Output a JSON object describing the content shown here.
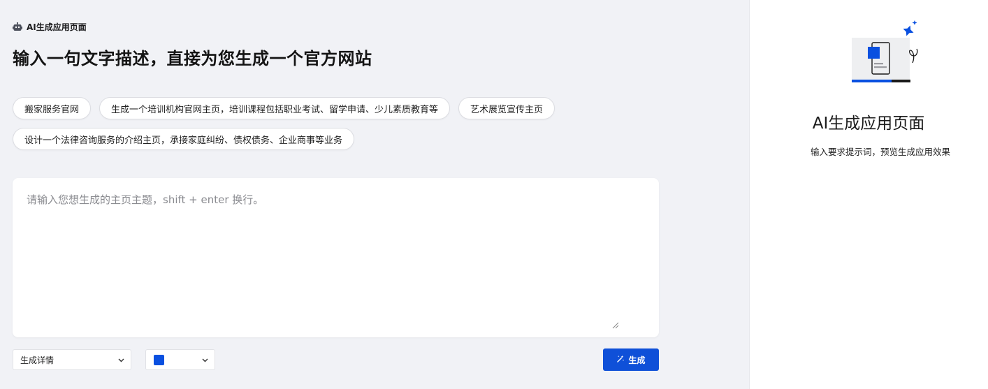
{
  "header": {
    "breadcrumb": "AI生成应用页面",
    "headline": "输入一句文字描述，直接为您生成一个官方网站",
    "robot_icon": "robot-icon"
  },
  "suggestions": [
    "搬家服务官网",
    "生成一个培训机构官网主页，培训课程包括职业考试、留学申请、少儿素质教育等",
    "艺术展览宣传主页",
    "设计一个法律咨询服务的介绍主页，承接家庭纠纷、债权债务、企业商事等业务"
  ],
  "prompt": {
    "value": "",
    "placeholder": "请输入您想生成的主页主题，shift + enter 换行。"
  },
  "controls": {
    "detail_select": "生成详情",
    "color_select_value": "#0a50e0",
    "generate_label": "生成"
  },
  "side_panel": {
    "title": "AI生成应用页面",
    "subtitle": "输入要求提示词，预览生成应用效果"
  },
  "colors": {
    "accent": "#0f50d8",
    "page_bg": "#f1f2f6",
    "panel_bg": "#ffffff"
  }
}
